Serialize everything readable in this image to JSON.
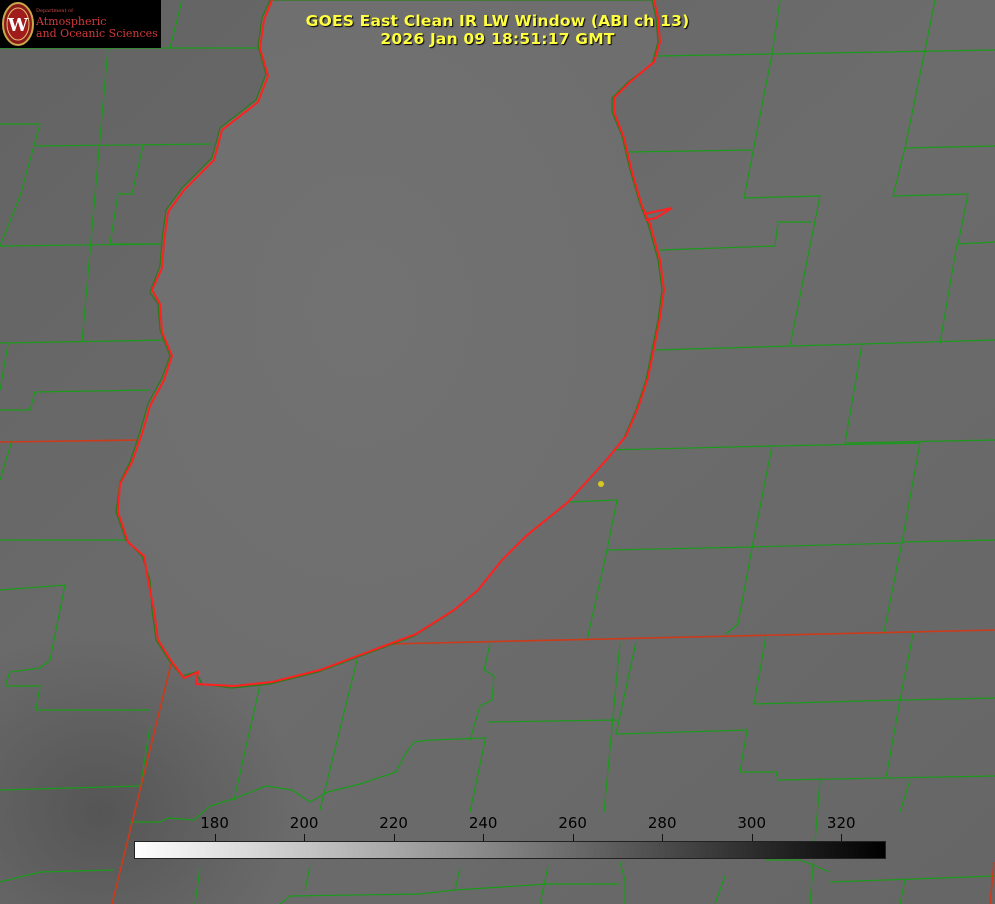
{
  "title": {
    "line1": "GOES East Clean IR LW Window (ABI ch 13)",
    "line2": "2026 Jan 09 18:51:17 GMT"
  },
  "logo": {
    "department": "Department of",
    "line1": "Atmospheric",
    "line2": "and Oceanic Sciences",
    "seal_letter": "W",
    "icon": "university-seal-icon"
  },
  "colorbar": {
    "ticks": [
      "180",
      "200",
      "220",
      "240",
      "260",
      "280",
      "300",
      "320"
    ],
    "tick_values": [
      180,
      200,
      220,
      240,
      260,
      280,
      300,
      320
    ],
    "range": [
      162,
      330
    ],
    "colormap": "white-to-black",
    "units": ""
  },
  "colors": {
    "title": "#ffff40",
    "county_lines": "#1a9a1a",
    "state_lines": "#cc3a1a",
    "coastline": "#ff2020",
    "marker": "#d8c820"
  }
}
